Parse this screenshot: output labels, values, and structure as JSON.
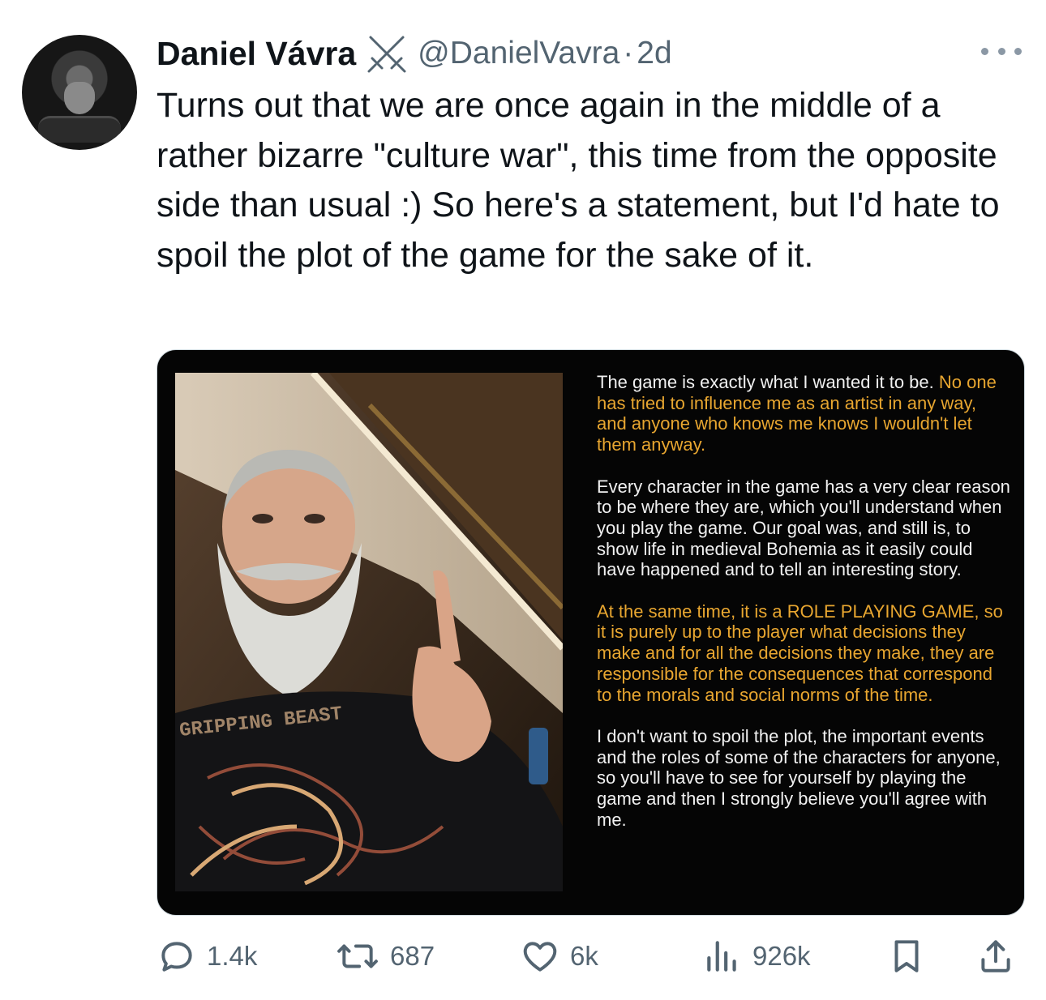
{
  "author": {
    "name": "Daniel Vávra",
    "handle": "@DanielVavra",
    "separator": "·",
    "time": "2d"
  },
  "tweet": {
    "text": "Turns out that we are once again in the middle of a rather bizarre \"culture war\", this time from the opposite side than usual :) So here's a statement, but I'd hate to spoil the plot of the game for the sake of it."
  },
  "media": {
    "shirt_text": "GRIPPING BEAST",
    "paragraphs": [
      {
        "white": "The game is exactly what I wanted it to be.",
        "yellow": "No one has tried to influence me as an artist in any way, and anyone who knows me knows I wouldn't let them anyway."
      },
      {
        "white": "Every character in the game has a very clear reason to be where they are, which you'll understand when you play the game. Our goal was, and still is, to show life in medieval Bohemia as it easily could have happened and to tell an interesting story.",
        "yellow": ""
      },
      {
        "white": "",
        "yellow": "At the same time, it is a ROLE PLAYING GAME, so it is purely up to the player what decisions they make and for all the decisions they make, they are responsible for the consequences that correspond to the morals and social norms of the time."
      },
      {
        "white": "I don't want to spoil the plot, the important events and the roles of some of the characters for anyone, so you'll have to see for yourself by playing the game and then I strongly believe you'll agree with me.",
        "yellow": ""
      }
    ],
    "colors": {
      "white_text": "#f1f1f1",
      "yellow_text": "#e8a630",
      "background": "#050505"
    }
  },
  "actions": {
    "replies": "1.4k",
    "reposts": "687",
    "likes": "6k",
    "views": "926k"
  },
  "icons": [
    "crossed-swords-badge-icon",
    "more-icon",
    "reply-icon",
    "repost-icon",
    "like-icon",
    "views-icon",
    "bookmark-icon",
    "share-icon"
  ],
  "colors": {
    "text": "#0f1419",
    "secondary": "#536471"
  }
}
